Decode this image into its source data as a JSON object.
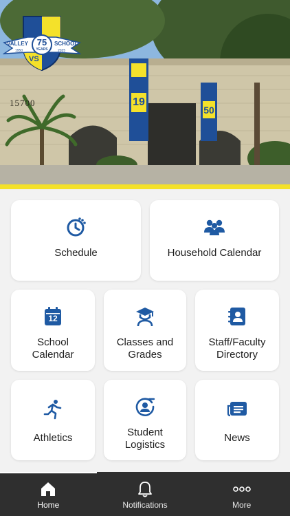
{
  "school": {
    "logo_left_text": "VALLEY",
    "logo_right_text": "SCHOOL",
    "logo_number": "75",
    "logo_years": "YEARS",
    "logo_start_year": "1950",
    "logo_end_year": "2025",
    "logo_initials": "VS",
    "building_number": "15700",
    "banner_left_text": "19",
    "banner_right_text": "50",
    "accent_color": "#f4e12a",
    "icon_color": "#1f5aa3"
  },
  "tiles": [
    {
      "label": "Schedule",
      "icon": "clock-icon"
    },
    {
      "label": "Household Calendar",
      "icon": "family-icon"
    },
    {
      "label": "School\nCalendar",
      "icon": "calendar-icon",
      "calendar_day": "12"
    },
    {
      "label": "Classes and\nGrades",
      "icon": "graduation-cap-icon"
    },
    {
      "label": "Staff/Faculty\nDirectory",
      "icon": "contact-book-icon"
    },
    {
      "label": "Athletics",
      "icon": "runner-icon"
    },
    {
      "label": "Student\nLogistics",
      "icon": "student-location-icon"
    },
    {
      "label": "News",
      "icon": "newspaper-icon"
    }
  ],
  "nav": {
    "items": [
      {
        "label": "Home",
        "icon": "home-icon",
        "active": true
      },
      {
        "label": "Notifications",
        "icon": "bell-icon",
        "active": false
      },
      {
        "label": "More",
        "icon": "more-dots-icon",
        "active": false
      }
    ]
  }
}
